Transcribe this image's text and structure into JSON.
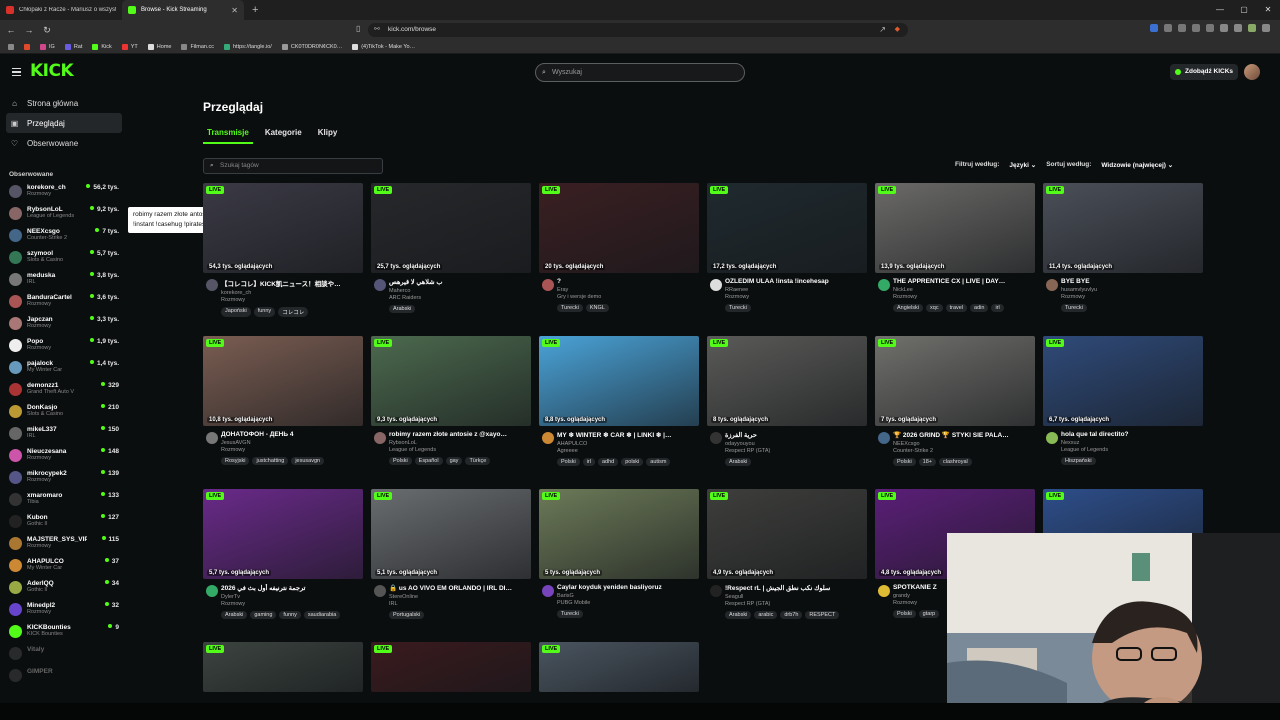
{
  "browser": {
    "tabs": [
      {
        "title": "Chłopaki z Racze - Mariusz o wszyst…",
        "color": "#d9302a"
      },
      {
        "title": "Browse - Kick Streaming",
        "color": "#53fc18"
      }
    ],
    "url": "kick.com/browse",
    "bookmarks": [
      {
        "label": "IG",
        "color": "#d0468a"
      },
      {
        "label": "Rat",
        "color": "#6a5ce0"
      },
      {
        "label": "Kick",
        "color": "#53fc18"
      },
      {
        "label": "YT",
        "color": "#e33"
      },
      {
        "label": "Home",
        "color": "#ddd"
      },
      {
        "label": "Filman.cc",
        "color": "#888"
      },
      {
        "label": "https://tangle.io/",
        "color": "#3a7"
      },
      {
        "label": "CK0T0DR0N¢CK0…",
        "color": "#999"
      },
      {
        "label": "(4)TikTok - Make Yo…",
        "color": "#ddd"
      }
    ]
  },
  "header": {
    "logo": "KICK",
    "search_placeholder": "Wyszukaj",
    "get_kicks": "Zdobądź KICKs"
  },
  "sidebar": {
    "nav": [
      {
        "label": "Strona główna",
        "icon": "home-icon",
        "glyph": "⌂"
      },
      {
        "label": "Przeglądaj",
        "icon": "browse-icon",
        "glyph": "▣"
      },
      {
        "label": "Obserwowane",
        "icon": "heart-icon",
        "glyph": "♡"
      }
    ],
    "followed_header": "Obserwowane",
    "channels": [
      {
        "name": "korekore_ch",
        "game": "Rozmowy",
        "viewers": "56,2 tys.",
        "color": "#556"
      },
      {
        "name": "RybsonLoL",
        "game": "League of Legends",
        "viewers": "9,2 tys.",
        "color": "#866"
      },
      {
        "name": "NEEXcsgo",
        "game": "Counter-Strike 2",
        "viewers": "7 tys.",
        "color": "#468"
      },
      {
        "name": "szymool",
        "game": "Slots & Casino",
        "viewers": "5,7 tys.",
        "color": "#375"
      },
      {
        "name": "meduska",
        "game": "IRL",
        "viewers": "3,8 tys.",
        "color": "#777"
      },
      {
        "name": "BanduraCartel",
        "game": "Rozmowy",
        "viewers": "3,6 tys.",
        "color": "#a55"
      },
      {
        "name": "Japczan",
        "game": "Rozmowy",
        "viewers": "3,3 tys.",
        "color": "#a77"
      },
      {
        "name": "Popo",
        "game": "Rozmowy",
        "viewers": "1,9 tys.",
        "color": "#eee"
      },
      {
        "name": "pajalock",
        "game": "My Winter Car",
        "viewers": "1,4 tys.",
        "color": "#69b"
      },
      {
        "name": "demonzz1",
        "game": "Grand Theft Auto V",
        "viewers": "329",
        "color": "#a33"
      },
      {
        "name": "DonKasjo",
        "game": "Slots & Casino",
        "viewers": "210",
        "color": "#b93"
      },
      {
        "name": "mikeL337",
        "game": "IRL",
        "viewers": "150",
        "color": "#666"
      },
      {
        "name": "Nieuczesana",
        "game": "Rozmowy",
        "viewers": "148",
        "color": "#c5a"
      },
      {
        "name": "mikrocypek2",
        "game": "Rozmowy",
        "viewers": "139",
        "color": "#558"
      },
      {
        "name": "xmaromaro",
        "game": "Tibia",
        "viewers": "133",
        "color": "#333"
      },
      {
        "name": "Kubon",
        "game": "Gothic II",
        "viewers": "127",
        "color": "#222"
      },
      {
        "name": "MAJSTER_SYS_VIP…",
        "game": "Rozmowy",
        "viewers": "115",
        "color": "#a73"
      },
      {
        "name": "AHAPULCO",
        "game": "My Winter Car",
        "viewers": "37",
        "color": "#c83"
      },
      {
        "name": "AderIQQ",
        "game": "Gothic II",
        "viewers": "34",
        "color": "#9a4"
      },
      {
        "name": "Minedpl2",
        "game": "Rozmowy",
        "viewers": "32",
        "color": "#64c"
      },
      {
        "name": "KICKBounties",
        "game": "KICK Bounties",
        "viewers": "9",
        "color": "#53fc18"
      }
    ],
    "offline": [
      {
        "name": "Vitaly",
        "color": "#555"
      },
      {
        "name": "GIMPER",
        "color": "#555"
      }
    ],
    "tooltip": "robimy razem złote antosie z @xayoo | !betclic !holy !instant !casehug !pirateswap"
  },
  "main": {
    "title": "Przeglądaj",
    "tabs": [
      "Transmisje",
      "Kategorie",
      "Klipy"
    ],
    "tag_search_placeholder": "Szukaj tagów",
    "filter_label": "Filtruj według:",
    "filter_value": "Języki",
    "sort_label": "Sortuj według:",
    "sort_value": "Widzowie (najwięcej)",
    "live_badge": "LIVE",
    "streams": [
      {
        "title": "【コレコレ】KICK凱ニュース！相談や…",
        "name": "korekore_ch",
        "category": "Rozmowy",
        "viewers": "54,3 tys. oglądających",
        "tags": [
          "Japoński",
          "funny",
          "コレコレ"
        ],
        "bg": "#3b3a45",
        "av": "#556"
      },
      {
        "title": "ب شلاهي لا قيرهص",
        "name": "Maherco",
        "category": "ARC Raiders",
        "viewers": "25,7 tys. oglądających",
        "tags": [
          "Arabski"
        ],
        "bg": "#26282b",
        "av": "#557"
      },
      {
        "title": "?",
        "name": "Eray",
        "category": "Gry i wersje demo",
        "viewers": "20 tys. oglądających",
        "tags": [
          "Turecki",
          "KNGL"
        ],
        "bg": "#3a1f22",
        "av": "#a55"
      },
      {
        "title": "OZLEDIM ULAA !insta !incehesap",
        "name": "RRaenee",
        "category": "Rozmowy",
        "viewers": "17,2 tys. oglądających",
        "tags": [
          "Turecki"
        ],
        "bg": "#1f2a2f",
        "av": "#ddd"
      },
      {
        "title": "THE APPRENTICE CX | LIVE | DAY…",
        "name": "NickLee",
        "category": "Rozmowy",
        "viewers": "13,9 tys. oglądających",
        "tags": [
          "Angielski",
          "xqc",
          "travel",
          "adin",
          "irl"
        ],
        "bg": "#6b6a68",
        "av": "#3a6"
      },
      {
        "title": "BYE BYE",
        "name": "husamvlyuvlyu",
        "category": "Rozmowy",
        "viewers": "11,4 tys. oglądających",
        "tags": [
          "Turecki"
        ],
        "bg": "#4b4f58",
        "av": "#865"
      },
      {
        "title": "ДОНАТОФОН - ДЕНЬ 4",
        "name": "JesusAVGN",
        "category": "Rozmowy",
        "viewers": "10,8 tys. oglądających",
        "tags": [
          "Rosyjski",
          "justchatting",
          "jesusavgn"
        ],
        "bg": "#7a5d52",
        "av": "#777"
      },
      {
        "title": "robimy razem złote antosie z @xayo…",
        "name": "RybsonLoL",
        "category": "League of Legends",
        "viewers": "9,3 tys. oglądających",
        "tags": [
          "Polski",
          "Español",
          "gay",
          "Türkçe"
        ],
        "bg": "#4c6a4e",
        "av": "#866"
      },
      {
        "title": "MY ❄ WINTER ❄ CAR ❄ | LINKI ❄ |…",
        "name": "AHAPULCO",
        "category": "Agreeee",
        "viewers": "8,8 tys. oglądających",
        "tags": [
          "Polski",
          "irl",
          "adhd",
          "polski",
          "autism"
        ],
        "bg": "#4aa3d8",
        "av": "#c83"
      },
      {
        "title": "حرية الفرزة",
        "name": "odayyouyou",
        "category": "Respect RP (GTA)",
        "viewers": "8 tys. oglądających",
        "tags": [
          "Arabski"
        ],
        "bg": "#5a5b58",
        "av": "#333"
      },
      {
        "title": "🏆 2026 GRIND 🏆 STYKI SIE PALA…",
        "name": "NEEXcsgo",
        "category": "Counter-Strike 2",
        "viewers": "7 tys. oglądających",
        "tags": [
          "Polski",
          "18+",
          "clashroyal"
        ],
        "bg": "#70706c",
        "av": "#468"
      },
      {
        "title": "hola que tal directito?",
        "name": "Nexxuz",
        "category": "League of Legends",
        "viewers": "6,7 tys. oglądających",
        "tags": [
          "Hiszpański"
        ],
        "bg": "#2f4b7a",
        "av": "#8b5"
      },
      {
        "title": "ترجمة نترنيفه أول بث في 2026",
        "name": "DylerTv",
        "category": "Rozmowy",
        "viewers": "5,7 tys. oglądających",
        "tags": [
          "Arabski",
          "gaming",
          "funny",
          "saudiarabia"
        ],
        "bg": "#6a2a8a",
        "av": "#3a6"
      },
      {
        "title": "🔒 us AO VIVO EM ORLANDO | IRL DI…",
        "name": "StereOnline",
        "category": "IRL",
        "viewers": "5,1 tys. oglądających",
        "tags": [
          "Portugalski"
        ],
        "bg": "#6a6d70",
        "av": "#555"
      },
      {
        "title": "Caylar koyduk yeniden basliyoruz",
        "name": "BarisG",
        "category": "PUBG Mobile",
        "viewers": "5 tys. oglądających",
        "tags": [
          "Turecki"
        ],
        "bg": "#6c7a58",
        "av": "#74b"
      },
      {
        "title": "!Respect rL | سلوك نكب نطق الجيش",
        "name": "Seagull",
        "category": "Respect RP (GTA)",
        "viewers": "4,9 tys. oglądających",
        "tags": [
          "Arabski",
          "arabic",
          "drb7h",
          "RESPECT"
        ],
        "bg": "#3e3f3c",
        "av": "#222"
      },
      {
        "title": "SPOTKANIE Z",
        "name": "grandy",
        "category": "Rozmowy",
        "viewers": "4,8 tys. oglądających",
        "tags": [
          "Polski",
          "gtarp"
        ],
        "bg": "#5b1f78",
        "av": "#db3"
      },
      {
        "title": "",
        "name": "",
        "category": "",
        "viewers": "",
        "tags": [],
        "bg": "#2d4e8a",
        "av": "#444"
      },
      {
        "title": "",
        "name": "",
        "category": "",
        "viewers": "",
        "tags": [],
        "bg": "#3c4440",
        "av": "#444"
      },
      {
        "title": "",
        "name": "",
        "category": "",
        "viewers": "",
        "tags": [],
        "bg": "#3a1a1e",
        "av": "#444"
      },
      {
        "title": "",
        "name": "",
        "category": "",
        "viewers": "",
        "tags": [],
        "bg": "#4a5560",
        "av": "#444"
      }
    ]
  },
  "colors": {
    "accent": "#53fc18",
    "bg": "#0b0e0f",
    "panel": "#24272a"
  }
}
